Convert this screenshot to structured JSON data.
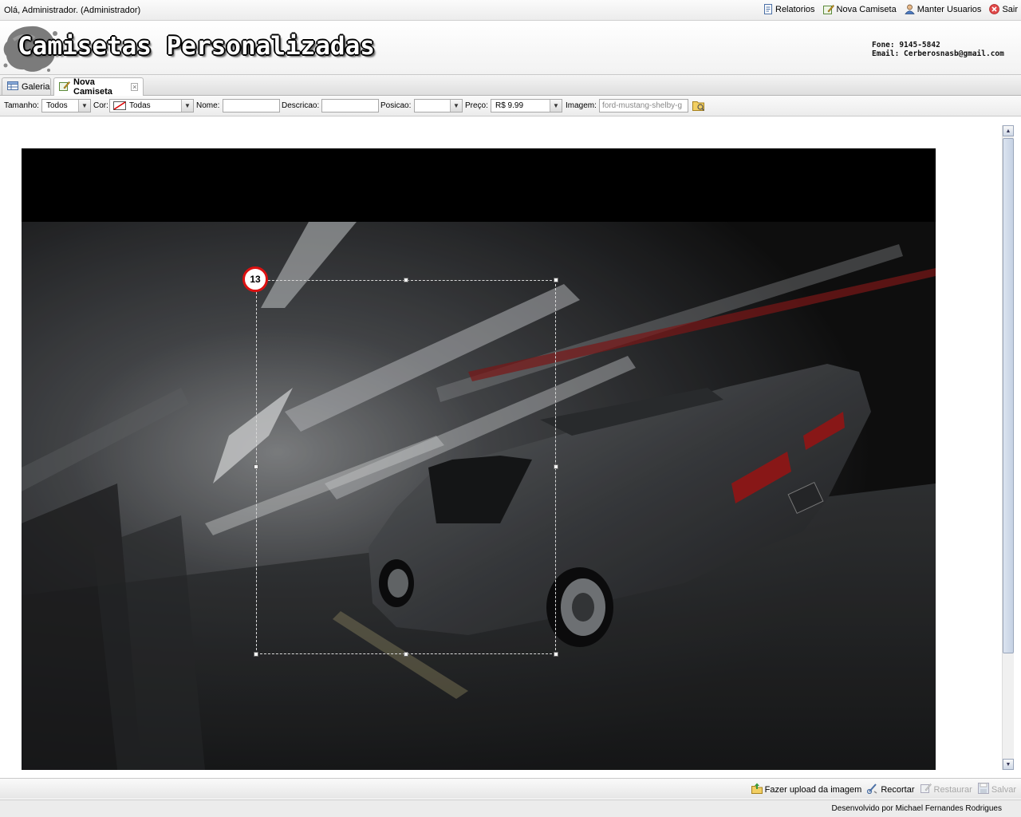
{
  "topbar": {
    "greeting": "Olá, Administrador. (Administrador)",
    "menu": [
      {
        "label": "Relatorios",
        "icon": "report-icon"
      },
      {
        "label": "Nova Camiseta",
        "icon": "pencil-icon"
      },
      {
        "label": "Manter Usuarios",
        "icon": "user-icon"
      },
      {
        "label": "Sair",
        "icon": "close-circle-icon"
      }
    ]
  },
  "header": {
    "logo_text": "Camisetas Personalizadas",
    "phone": "Fone: 9145-5842",
    "email": "Email: Cerberosnasb@gmail.com"
  },
  "tabs": [
    {
      "label": "Galeria",
      "icon": "table-icon",
      "active": false
    },
    {
      "label": "Nova Camiseta",
      "icon": "pencil-icon",
      "active": true
    }
  ],
  "toolbar": {
    "tamanho_label": "Tamanho:",
    "tamanho_value": "Todos",
    "cor_label": "Cor:",
    "cor_value": "Todas",
    "nome_label": "Nome:",
    "nome_value": "",
    "descricao_label": "Descricao:",
    "descricao_value": "",
    "posicao_label": "Posicao:",
    "posicao_value": "",
    "preco_label": "Preço:",
    "preco_value": "R$ 9.99",
    "imagem_label": "Imagem:",
    "imagem_value": "ford-mustang-shelby-g"
  },
  "editor": {
    "marker_number": "13"
  },
  "actions": [
    {
      "label": "Fazer upload da imagem",
      "icon": "upload-icon",
      "enabled": true
    },
    {
      "label": "Recortar",
      "icon": "crop-icon",
      "enabled": true
    },
    {
      "label": "Restaurar",
      "icon": "restore-icon",
      "enabled": false
    },
    {
      "label": "Salvar",
      "icon": "save-icon",
      "enabled": false
    }
  ],
  "footer": {
    "text": "Desenvolvido por Michael Fernandes Rodrigues"
  },
  "colors": {
    "marker_ring": "#dd1111",
    "accent": "#c6d2e4"
  }
}
